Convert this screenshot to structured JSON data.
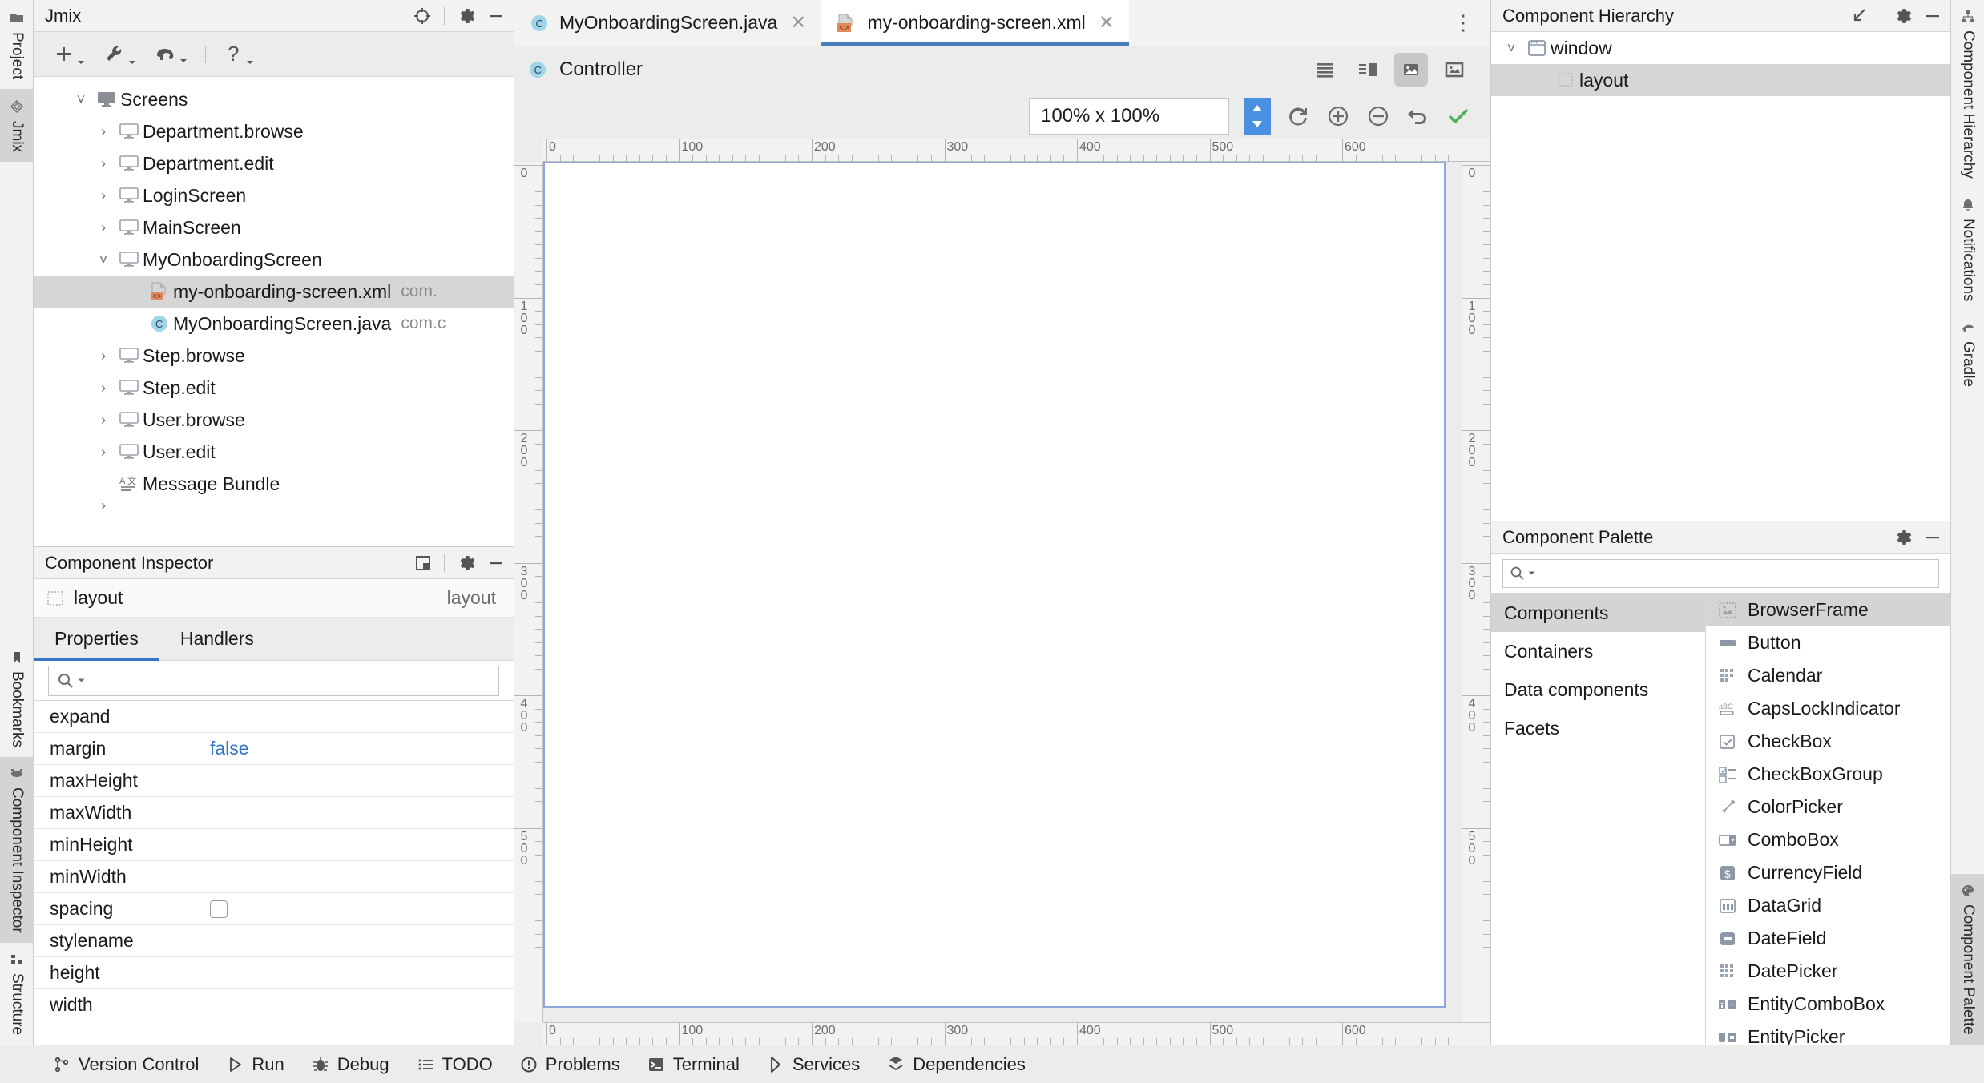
{
  "left_stripe": [
    {
      "label": "Project",
      "icon": "folder-icon",
      "selected": false
    },
    {
      "label": "Jmix",
      "icon": "jmix-icon",
      "selected": true
    },
    {
      "label": "Bookmarks",
      "icon": "bookmark-icon",
      "selected": false
    },
    {
      "label": "Component Inspector",
      "icon": "inspector-icon",
      "selected": true
    },
    {
      "label": "Structure",
      "icon": "structure-icon",
      "selected": false
    }
  ],
  "right_stripe": [
    {
      "label": "Component Hierarchy",
      "icon": "hierarchy-icon",
      "selected": false
    },
    {
      "label": "Notifications",
      "icon": "bell-icon",
      "selected": false
    },
    {
      "label": "Gradle",
      "icon": "gradle-icon",
      "selected": false
    },
    {
      "label": "Component Palette",
      "icon": "palette-icon",
      "selected": true
    }
  ],
  "jmix_panel": {
    "title": "Jmix",
    "header_icons": [
      "locate-icon",
      "gear-icon",
      "minimize-icon"
    ],
    "toolbar": [
      {
        "name": "add-icon",
        "glyph": "+"
      },
      {
        "name": "wrench-icon",
        "glyph": "wrench"
      },
      {
        "name": "elephant-icon",
        "glyph": "elephant"
      },
      {
        "name": "help-icon",
        "glyph": "?"
      }
    ],
    "tree": [
      {
        "label": "Screens",
        "indent": 0,
        "arrow": "down",
        "icon": "screens-icon",
        "selected": false,
        "sub": ""
      },
      {
        "label": "Department.browse",
        "indent": 1,
        "arrow": "right",
        "icon": "screen-icon",
        "selected": false,
        "sub": ""
      },
      {
        "label": "Department.edit",
        "indent": 1,
        "arrow": "right",
        "icon": "screen-icon",
        "selected": false,
        "sub": ""
      },
      {
        "label": "LoginScreen",
        "indent": 1,
        "arrow": "right",
        "icon": "screen-icon",
        "selected": false,
        "sub": ""
      },
      {
        "label": "MainScreen",
        "indent": 1,
        "arrow": "right",
        "icon": "screen-icon",
        "selected": false,
        "sub": ""
      },
      {
        "label": "MyOnboardingScreen",
        "indent": 1,
        "arrow": "down",
        "icon": "screen-icon",
        "selected": false,
        "sub": ""
      },
      {
        "label": "my-onboarding-screen.xml",
        "indent": 2,
        "arrow": "none",
        "icon": "xml-file-icon",
        "selected": true,
        "sub": "com."
      },
      {
        "label": "MyOnboardingScreen.java",
        "indent": 2,
        "arrow": "none",
        "icon": "java-class-icon",
        "selected": false,
        "sub": "com.c"
      },
      {
        "label": "Step.browse",
        "indent": 1,
        "arrow": "right",
        "icon": "screen-icon",
        "selected": false,
        "sub": ""
      },
      {
        "label": "Step.edit",
        "indent": 1,
        "arrow": "right",
        "icon": "screen-icon",
        "selected": false,
        "sub": ""
      },
      {
        "label": "User.browse",
        "indent": 1,
        "arrow": "right",
        "icon": "screen-icon",
        "selected": false,
        "sub": ""
      },
      {
        "label": "User.edit",
        "indent": 1,
        "arrow": "right",
        "icon": "screen-icon",
        "selected": false,
        "sub": ""
      },
      {
        "label": "Message Bundle",
        "indent": 1,
        "arrow": "none",
        "icon": "bundle-icon",
        "selected": false,
        "sub": ""
      }
    ]
  },
  "inspector": {
    "title": "Component Inspector",
    "header_icons": [
      "window-mode-icon",
      "gear-icon",
      "minimize-icon"
    ],
    "target_name": "layout",
    "target_type": "layout",
    "tabs": [
      {
        "label": "Properties",
        "active": true
      },
      {
        "label": "Handlers",
        "active": false
      }
    ],
    "search_placeholder": "",
    "properties": [
      {
        "name": "expand",
        "value": "",
        "kind": "text"
      },
      {
        "name": "margin",
        "value": "false",
        "kind": "link"
      },
      {
        "name": "maxHeight",
        "value": "",
        "kind": "text"
      },
      {
        "name": "maxWidth",
        "value": "",
        "kind": "text"
      },
      {
        "name": "minHeight",
        "value": "",
        "kind": "text"
      },
      {
        "name": "minWidth",
        "value": "",
        "kind": "text"
      },
      {
        "name": "spacing",
        "value": "",
        "kind": "checkbox"
      },
      {
        "name": "stylename",
        "value": "",
        "kind": "text"
      },
      {
        "name": "height",
        "value": "",
        "kind": "text"
      },
      {
        "name": "width",
        "value": "",
        "kind": "text"
      }
    ]
  },
  "editor": {
    "tabs": [
      {
        "label": "MyOnboardingScreen.java",
        "icon": "java-class-icon",
        "active": false,
        "closable": true
      },
      {
        "label": "my-onboarding-screen.xml",
        "icon": "xml-file-icon",
        "active": true,
        "closable": true
      }
    ],
    "overflow_icon": "more-vertical-icon",
    "designer": {
      "controller_label": "Controller",
      "controller_icon": "java-class-icon",
      "view_modes": [
        {
          "name": "text-mode-icon",
          "selected": false
        },
        {
          "name": "split-mode-icon",
          "selected": false
        },
        {
          "name": "design-mode-icon",
          "selected": true
        },
        {
          "name": "preview-mode-icon",
          "selected": false
        }
      ],
      "zoom_value": "100% x 100%",
      "zoom_actions": [
        {
          "name": "refresh-icon"
        },
        {
          "name": "zoom-in-icon"
        },
        {
          "name": "zoom-out-icon"
        },
        {
          "name": "undo-icon"
        },
        {
          "name": "apply-icon"
        }
      ]
    },
    "ruler": {
      "h_labels": [
        "0",
        "100",
        "200",
        "300",
        "400",
        "500",
        "600"
      ],
      "v_labels": [
        "0",
        "100",
        "200",
        "300",
        "400",
        "500"
      ]
    }
  },
  "hierarchy": {
    "title": "Component Hierarchy",
    "header_icons": [
      "collapse-icon",
      "gear-icon",
      "minimize-icon"
    ],
    "nodes": [
      {
        "label": "window",
        "indent": 0,
        "arrow": "down",
        "icon": "window-icon",
        "selected": false
      },
      {
        "label": "layout",
        "indent": 1,
        "arrow": "none",
        "icon": "layout-icon",
        "selected": true
      }
    ]
  },
  "palette": {
    "title": "Component Palette",
    "header_icons": [
      "gear-icon",
      "minimize-icon"
    ],
    "search_placeholder": "",
    "categories": [
      {
        "label": "Components",
        "selected": true
      },
      {
        "label": "Containers",
        "selected": false
      },
      {
        "label": "Data components",
        "selected": false
      },
      {
        "label": "Facets",
        "selected": false
      }
    ],
    "items": [
      {
        "label": "BrowserFrame",
        "icon": "browserframe-icon",
        "selected": true
      },
      {
        "label": "Button",
        "icon": "button-icon",
        "selected": false
      },
      {
        "label": "Calendar",
        "icon": "calendar-icon",
        "selected": false
      },
      {
        "label": "CapsLockIndicator",
        "icon": "capslock-icon",
        "selected": false
      },
      {
        "label": "CheckBox",
        "icon": "checkbox-icon",
        "selected": false
      },
      {
        "label": "CheckBoxGroup",
        "icon": "checkboxgroup-icon",
        "selected": false
      },
      {
        "label": "ColorPicker",
        "icon": "colorpicker-icon",
        "selected": false
      },
      {
        "label": "ComboBox",
        "icon": "combobox-icon",
        "selected": false
      },
      {
        "label": "CurrencyField",
        "icon": "currencyfield-icon",
        "selected": false
      },
      {
        "label": "DataGrid",
        "icon": "datagrid-icon",
        "selected": false
      },
      {
        "label": "DateField",
        "icon": "datefield-icon",
        "selected": false
      },
      {
        "label": "DatePicker",
        "icon": "datepicker-icon",
        "selected": false
      },
      {
        "label": "EntityComboBox",
        "icon": "entitycombobox-icon",
        "selected": false
      },
      {
        "label": "EntityPicker",
        "icon": "entitypicker-icon",
        "selected": false
      }
    ]
  },
  "statusbar": [
    {
      "label": "Version Control",
      "icon": "branch-icon"
    },
    {
      "label": "Run",
      "icon": "run-icon"
    },
    {
      "label": "Debug",
      "icon": "debug-icon"
    },
    {
      "label": "TODO",
      "icon": "todo-icon"
    },
    {
      "label": "Problems",
      "icon": "problems-icon"
    },
    {
      "label": "Terminal",
      "icon": "terminal-icon"
    },
    {
      "label": "Services",
      "icon": "services-icon"
    },
    {
      "label": "Dependencies",
      "icon": "dependencies-icon"
    }
  ],
  "colors": {
    "accent": "#3573c8",
    "tab_underline": "#4a7ebb",
    "selection": "#d4d4d4",
    "canvas_border": "#8fa8de",
    "spinner": "#4a90e2",
    "xml_badge": "#e08a5a",
    "java_badge": "#a0d4ea",
    "check_green": "#4caf50"
  }
}
